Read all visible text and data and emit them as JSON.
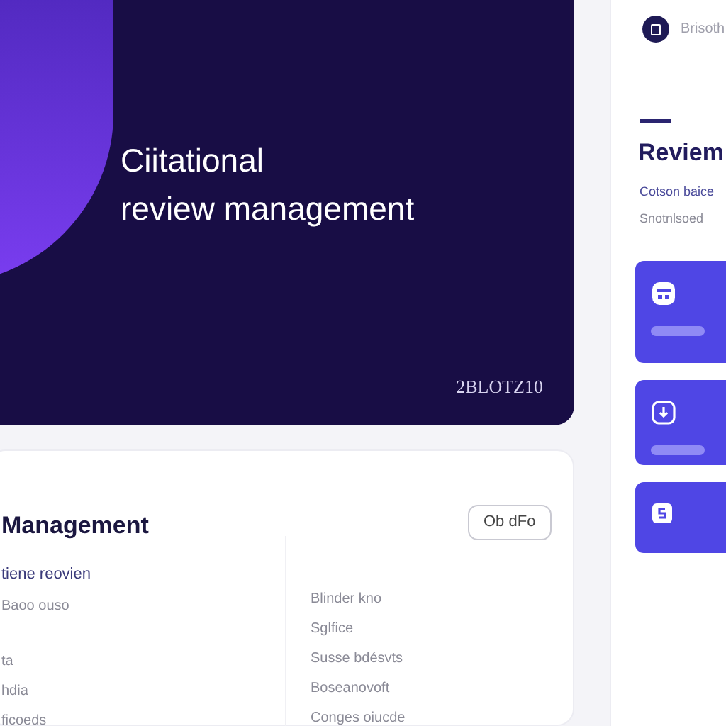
{
  "hero": {
    "title_lines": [
      "Ciitational",
      "review management"
    ],
    "date": "2BLOTZ10"
  },
  "main_card": {
    "title": "Management",
    "button": "Ob dFo",
    "left_lines": [
      {
        "text": "tiene reovien",
        "kind": "accent"
      },
      {
        "text": "Baoo ouso",
        "kind": "muted"
      },
      {
        "text": "ta",
        "kind": "muted"
      },
      {
        "text": "hdia",
        "kind": "muted"
      },
      {
        "text": "ficoeds",
        "kind": "muted"
      }
    ],
    "right_lines": [
      "Blinder kno",
      "Sglfice",
      "Susse bdésvts",
      "Boseanovoft",
      "Conges oiucde"
    ]
  },
  "sidebar": {
    "user": "Brisoth",
    "title": "Reviem",
    "subtitle": "Cotson baice",
    "caption": "Snotnlsoed",
    "tiles": [
      {
        "kind": "box",
        "bar": true
      },
      {
        "kind": "download",
        "bar": true
      },
      {
        "kind": "s",
        "bar": false
      }
    ]
  }
}
